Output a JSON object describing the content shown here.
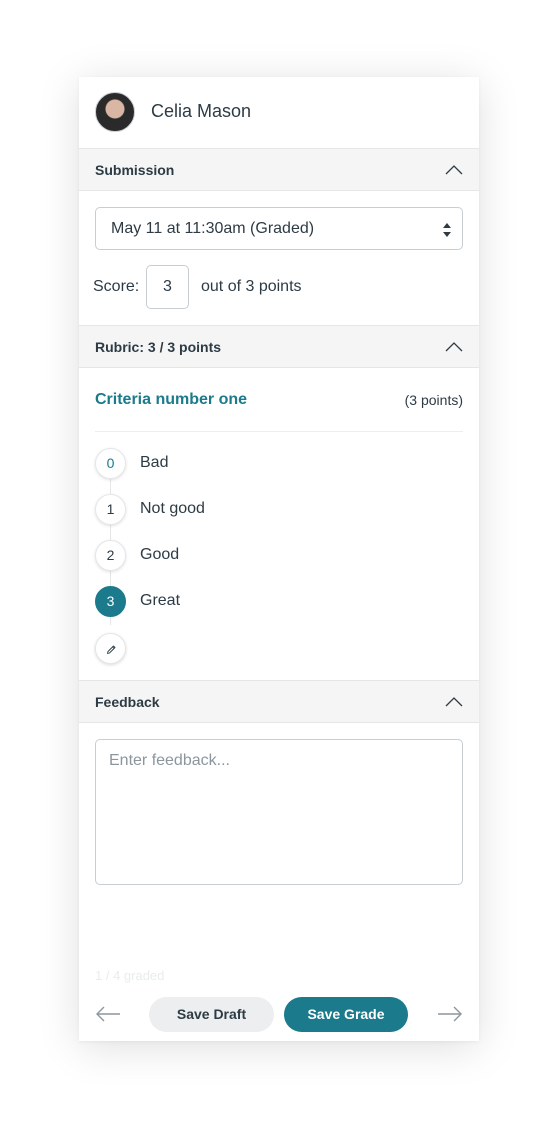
{
  "user": {
    "name": "Celia Mason",
    "avatar_icon": "user-avatar-photo"
  },
  "submission": {
    "section_title": "Submission",
    "selected_attempt": "May 11 at 11:30am (Graded)",
    "score_label": "Score:",
    "score_value": "3",
    "out_of_text": "out of  3 points"
  },
  "rubric": {
    "section_title": "Rubric: 3 / 3 points",
    "criteria": {
      "title": "Criteria number one",
      "points": "(3 points)"
    },
    "ratings": [
      {
        "value": "0",
        "label": "Bad",
        "selected": false
      },
      {
        "value": "1",
        "label": "Not good",
        "selected": false
      },
      {
        "value": "2",
        "label": "Good",
        "selected": false
      },
      {
        "value": "3",
        "label": "Great",
        "selected": true
      }
    ],
    "edit_icon": "pencil-icon"
  },
  "feedback": {
    "section_title": "Feedback",
    "placeholder": "Enter feedback..."
  },
  "footer": {
    "faded_text": "1 / 4 graded",
    "save_draft_label": "Save Draft",
    "save_grade_label": "Save Grade",
    "prev_icon": "arrow-left-icon",
    "next_icon": "arrow-right-icon"
  },
  "colors": {
    "accent": "#1b7a8c",
    "text": "#2d3b45",
    "section_bg": "#f5f5f5",
    "border": "#c7cdd1"
  }
}
